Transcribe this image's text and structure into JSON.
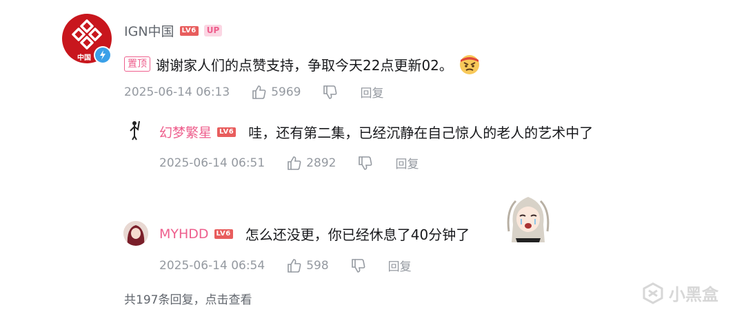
{
  "main_comment": {
    "username": "IGN中国",
    "level_badge": "LV6",
    "up_badge": "UP",
    "avatar_text": "中国",
    "pinned_label": "置顶",
    "text": "谢谢家人们的点赞支持，争取今天22点更新02。",
    "timestamp": "2025-06-14 06:13",
    "likes": "5969",
    "reply_label": "回复"
  },
  "replies": [
    {
      "username": "幻梦繁星",
      "level_badge": "LV6",
      "text": "哇，还有第二集，已经沉静在自己惊人的老人的艺术中了",
      "timestamp": "2025-06-14 06:51",
      "likes": "2892",
      "reply_label": "回复"
    },
    {
      "username": "MYHDD",
      "level_badge": "LV6",
      "text": "怎么还没更，你已经休息了40分钟了",
      "timestamp": "2025-06-14 06:54",
      "likes": "598",
      "reply_label": "回复"
    }
  ],
  "view_more": "共197条回复，点击查看",
  "watermark": "小黑盒",
  "colors": {
    "accent_pink": "#ee5f8d",
    "level_red": "#e85d5d",
    "meta_gray": "#9499a0",
    "ign_red": "#c8161d"
  }
}
